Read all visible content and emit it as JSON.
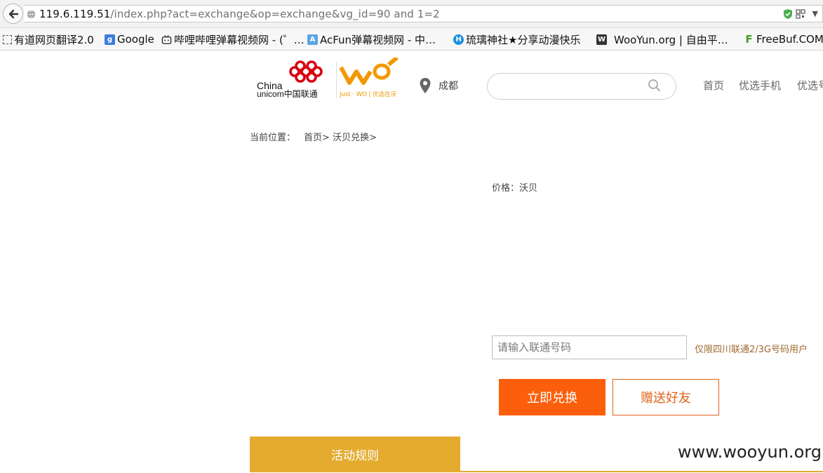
{
  "browser": {
    "url_host": "119.6.119.51",
    "url_path": "/index.php?act=exchange&op=exchange&vg_id=90 and 1=2",
    "bookmarks": [
      {
        "label": "有道网页翻译2.0",
        "icon": "dotted-box-icon"
      },
      {
        "label": "Google",
        "icon": "google-icon"
      },
      {
        "label": "哔哩哔哩弹幕视频网 - (゜…",
        "icon": "bilibili-icon"
      },
      {
        "label": "AcFun弹幕视频网 - 中…",
        "icon": "acfun-icon"
      },
      {
        "label": "琉璃神社★分享动漫快乐",
        "icon": "hacg-icon"
      },
      {
        "label": "WooYun.org | 自由平…",
        "icon": "wooyun-icon"
      },
      {
        "label": "FreeBuf.COM",
        "icon": "freebuf-icon"
      }
    ]
  },
  "header": {
    "logo_china": "China",
    "logo_unicom": "unicom中国联通",
    "logo_slogan": "Just · WO | 优选在沃",
    "city": "成都",
    "search_placeholder": "",
    "nav": [
      "首页",
      "优选手机",
      "优选号"
    ]
  },
  "main": {
    "breadcrumb_label": "当前位置：",
    "breadcrumb_home": "首页>",
    "breadcrumb_current": "沃贝兑换>",
    "price_label": "价格：",
    "price_value": "沃贝",
    "phone_placeholder": "请输入联通号码",
    "hint": "仅限四川联通2/3G号码用户",
    "exchange_button": "立即兑换",
    "gift_button": "赠送好友",
    "tab_rules": "活动规则"
  },
  "watermark": "www.wooyun.org",
  "colors": {
    "exchange_button": "#fb5f0b",
    "gift_button_border": "#e0621a",
    "tab": "#e4ab2f",
    "unicom_red": "#d7000f",
    "wo_orange": "#f39800"
  }
}
